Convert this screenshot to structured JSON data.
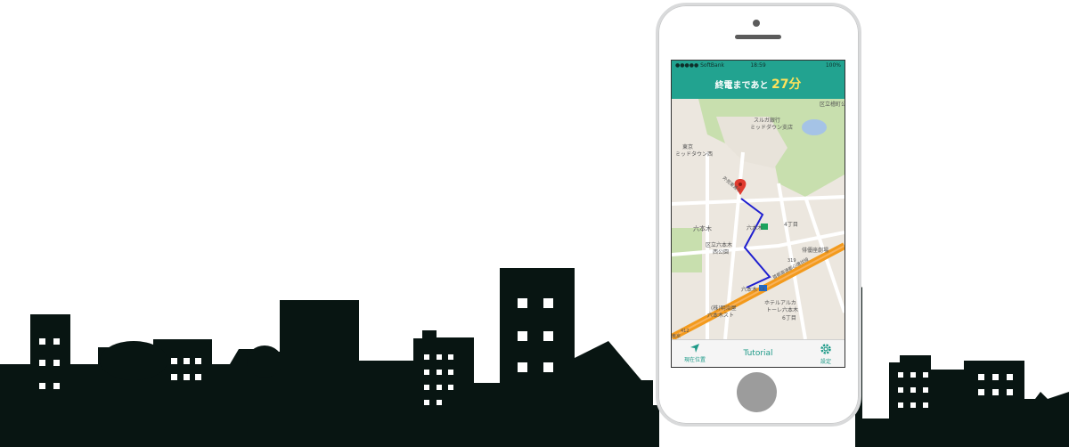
{
  "status_bar": {
    "carrier": "●●●●● SoftBank",
    "time": "18:59",
    "battery": "100%"
  },
  "header": {
    "prefix": "終電まであと",
    "minutes": "27分"
  },
  "map": {
    "labels": {
      "park_top": "区立檜町公園",
      "bank": "スルガ銀行",
      "bank_branch": "ミッドダウン支店",
      "tokyo": "東京",
      "midtown": "ミッドタウン西",
      "roppongi_area": "六本木",
      "park_bottom": "区立六本木",
      "park_bottom2": "西公園",
      "station_top": "六本木",
      "station_bottom": "六本木",
      "theater": "俳優座劇場",
      "chome4": "4丁目",
      "chome6": "6丁目",
      "hotel": "ホテルアルカ",
      "hotel2": "トーレ六本木",
      "company": "(株)明治屋",
      "company2": "六本木スト",
      "highway": "首都高速都心環状線",
      "route319": "319",
      "route412": "412",
      "route_left": "外苑東通り",
      "bottom_left": "東京",
      "gov_badge": "C8"
    }
  },
  "tabbar": {
    "locate_label": "現在位置",
    "tutorial_label": "Tutorial",
    "settings_label": "設定"
  },
  "colors": {
    "accent": "#22a390",
    "minutes": "#ffe25a",
    "skyline": "#081512",
    "route": "#1f1fd0",
    "highway": "#f39a1c"
  },
  "icons": {
    "locate": "navigation-arrow-icon",
    "settings": "gear-icon",
    "pin": "map-pin-icon"
  }
}
